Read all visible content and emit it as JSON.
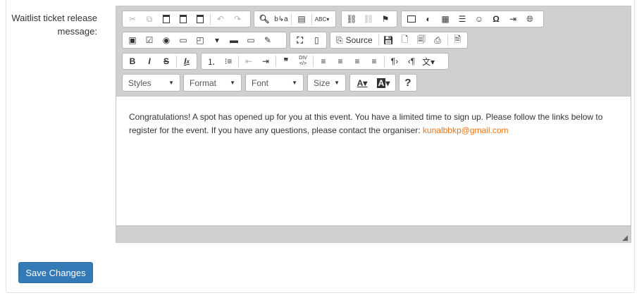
{
  "field": {
    "label": "Waitlist ticket release message:"
  },
  "toolbar": {
    "source_label": "Source",
    "styles": "Styles",
    "format": "Format",
    "font": "Font",
    "size": "Size",
    "help": "?",
    "spellcheck_abbr": "ABC",
    "div_abbr": "DIV"
  },
  "editor": {
    "message": "Congratulations! A spot has opened up for you at this event. You have a limited time to sign up. Please follow the links below to register for the event. If you have any questions, please contact the organiser: ",
    "email": "kunalbbkp@gmail.com"
  },
  "actions": {
    "save_label": "Save Changes"
  },
  "colors": {
    "primary": "#337ab7",
    "link": "#e8741a",
    "toolbar_bg": "#cfd1cf"
  }
}
